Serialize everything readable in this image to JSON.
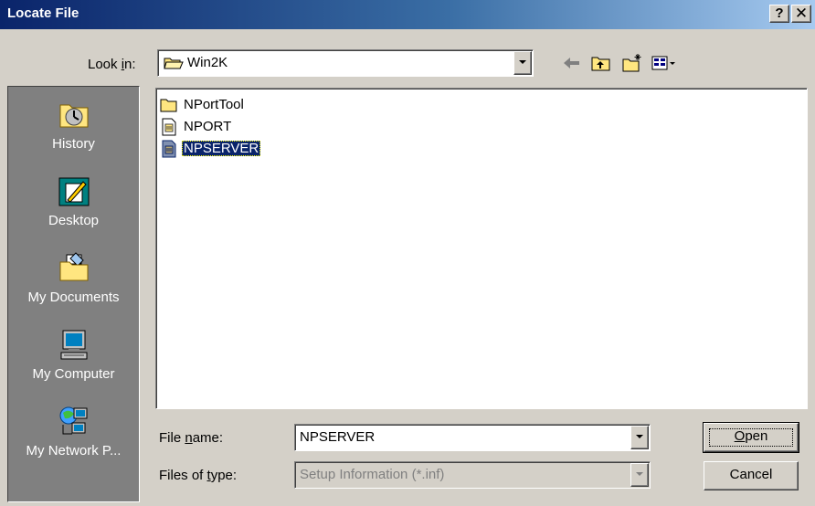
{
  "window": {
    "title": "Locate File",
    "help_button": "?",
    "close_button": "✕"
  },
  "lookin": {
    "label_pre": "Look ",
    "label_accel": "i",
    "label_post": "n:",
    "value": "Win2K"
  },
  "toolbar": {
    "back_icon": "back-arrow-icon",
    "up_icon": "up-folder-icon",
    "new_folder_icon": "new-folder-icon",
    "view_icon": "view-menu-icon"
  },
  "places": [
    {
      "label": "History",
      "icon": "history-icon"
    },
    {
      "label": "Desktop",
      "icon": "desktop-icon"
    },
    {
      "label": "My Documents",
      "icon": "my-documents-icon"
    },
    {
      "label": "My Computer",
      "icon": "my-computer-icon"
    },
    {
      "label": "My Network P...",
      "icon": "network-places-icon"
    }
  ],
  "files": [
    {
      "name": "NPortTool",
      "type": "folder"
    },
    {
      "name": "NPORT",
      "type": "setup-info"
    },
    {
      "name": "NPSERVER",
      "type": "setup-info",
      "selected": true
    }
  ],
  "filename": {
    "label_pre": "File ",
    "label_accel": "n",
    "label_post": "ame:",
    "value": "NPSERVER"
  },
  "filetype": {
    "label_pre": "Files of ",
    "label_accel": "t",
    "label_post": "ype:",
    "value": "Setup Information (*.inf)"
  },
  "buttons": {
    "open_accel": "O",
    "open_rest": "pen",
    "cancel": "Cancel"
  },
  "colors": {
    "titlebar_start": "#0a246a",
    "titlebar_end": "#a6caf0",
    "face": "#d4d0c8",
    "places_bg": "#808080",
    "selection": "#0a246a"
  }
}
